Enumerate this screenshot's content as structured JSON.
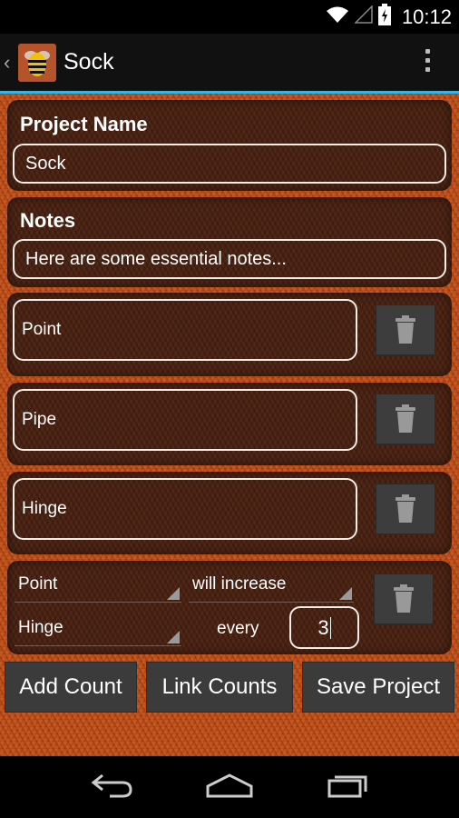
{
  "status_bar": {
    "time": "10:12",
    "icons": [
      "wifi-icon",
      "signal-icon",
      "battery-charging-icon"
    ]
  },
  "action_bar": {
    "title": "Sock",
    "icon": "bee-app-icon",
    "overflow_icon": "overflow-menu-icon",
    "up_icon": "up-caret-icon"
  },
  "project": {
    "name_label": "Project Name",
    "name_value": "Sock",
    "notes_label": "Notes",
    "notes_value": "Here are some essential notes..."
  },
  "counts": [
    {
      "name": "Point",
      "delete_icon": "trash-icon"
    },
    {
      "name": "Pipe",
      "delete_icon": "trash-icon"
    },
    {
      "name": "Hinge",
      "delete_icon": "trash-icon"
    }
  ],
  "link": {
    "source_count": "Point",
    "action": "will increase",
    "target_count": "Hinge",
    "every_label": "every",
    "interval": "3",
    "delete_icon": "trash-icon"
  },
  "buttons": {
    "add_count": "Add Count",
    "link_counts": "Link Counts",
    "save_project": "Save Project"
  },
  "nav_bar": {
    "icons": [
      "back-icon",
      "home-icon",
      "recent-apps-icon"
    ]
  },
  "colors": {
    "accent": "#33b5e5",
    "background_knit": "#c8541c",
    "card": "#4a2212",
    "button": "#3b3b3b"
  }
}
